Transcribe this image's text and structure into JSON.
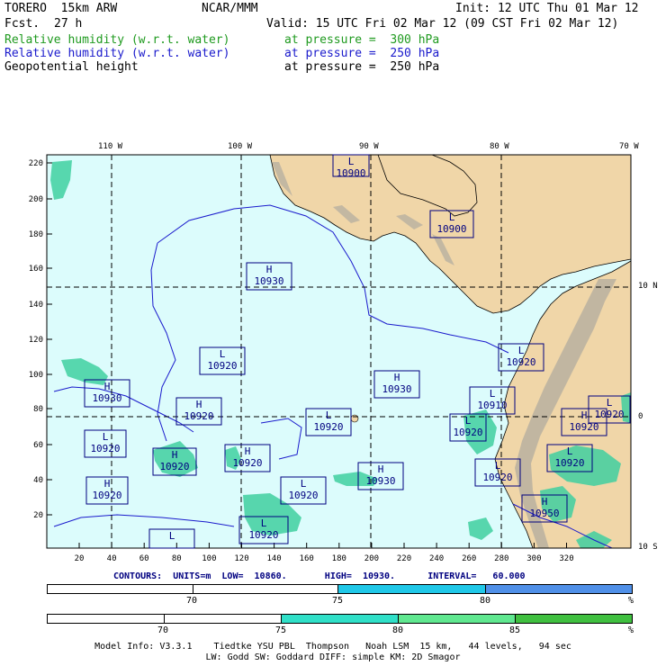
{
  "header": {
    "model": "TORERO  15km ARW",
    "org": "NCAR/MMM",
    "init": "Init: 12 UTC Thu 01 Mar 12",
    "fcst_label": "Fcst.",
    "fcst_value": "27 h",
    "valid": "Valid: 15 UTC Fri 02 Mar 12 (09 CST Fri 02 Mar 12)",
    "fields": [
      {
        "name": "Relative humidity (w.r.t. water)",
        "pressure": "at pressure =  300 hPa",
        "color": "#1f9a1f"
      },
      {
        "name": "Relative humidity (w.r.t. water)",
        "pressure": "at pressure =  250 hPa",
        "color": "#1a1acc"
      },
      {
        "name": "Geopotential height",
        "pressure": "at pressure =  250 hPa",
        "color": "#000000"
      }
    ]
  },
  "map": {
    "lon_labels": [
      "110 W",
      "100 W",
      "90 W",
      "80 W",
      "70 W"
    ],
    "lat_labels": [
      "10 N",
      "0",
      "10 S"
    ],
    "left_ticks": [
      "220",
      "200",
      "180",
      "160",
      "140",
      "120",
      "100",
      "80",
      "60",
      "40",
      "20"
    ],
    "bottom_ticks": [
      "20",
      "40",
      "60",
      "80",
      "100",
      "120",
      "140",
      "160",
      "180",
      "200",
      "220",
      "240",
      "260",
      "280",
      "300",
      "320"
    ],
    "colors": {
      "ocean": "#dcfcfc",
      "land": "#f0d6a8",
      "terrain": "#b8b0a0",
      "rh300": "#40d0a0",
      "box": "#000080"
    },
    "centers": [
      {
        "type": "L",
        "value": "10900"
      },
      {
        "type": "L",
        "value": "10900"
      },
      {
        "type": "H",
        "value": "10930"
      },
      {
        "type": "L",
        "value": "10920"
      },
      {
        "type": "L",
        "value": "10920"
      },
      {
        "type": "H",
        "value": "10930"
      },
      {
        "type": "H",
        "value": "10930"
      },
      {
        "type": "L",
        "value": "10910"
      },
      {
        "type": "L",
        "value": "10920"
      },
      {
        "type": "H",
        "value": "10920"
      },
      {
        "type": "L",
        "value": "10920"
      },
      {
        "type": "L",
        "value": "10920"
      },
      {
        "type": "H",
        "value": "10920"
      },
      {
        "type": "H",
        "value": "10920"
      },
      {
        "type": "H",
        "value": "10920"
      },
      {
        "type": "L",
        "value": "10920"
      },
      {
        "type": "H",
        "value": "10930"
      },
      {
        "type": "L",
        "value": "10920"
      },
      {
        "type": "L",
        "value": "10920"
      },
      {
        "type": "L",
        "value": "10920"
      },
      {
        "type": "H",
        "value": "10920"
      },
      {
        "type": "L",
        "value": "10920"
      },
      {
        "type": "H",
        "value": "10950"
      },
      {
        "type": "L",
        "value": ""
      }
    ]
  },
  "contours": {
    "text": "CONTOURS:  UNITS=m  LOW=  10860.       HIGH=  10930.      INTERVAL=   60.000"
  },
  "colorbar1": {
    "labels": [
      "70",
      "75",
      "80"
    ],
    "unit": "%",
    "colors": [
      "#ffffff",
      "#ffffff",
      "#20c8e8",
      "#5090e8"
    ]
  },
  "colorbar2": {
    "labels": [
      "70",
      "75",
      "80",
      "85"
    ],
    "unit": "%",
    "colors": [
      "#ffffff",
      "#ffffff",
      "#30e0c8",
      "#60e890",
      "#40c040"
    ]
  },
  "footer": {
    "line1": "Model Info: V3.3.1    Tiedtke YSU PBL  Thompson   Noah LSM  15 km,   44 levels,   94 sec",
    "line2": "LW: Godd SW: Goddard DIFF: simple KM: 2D Smagor"
  }
}
